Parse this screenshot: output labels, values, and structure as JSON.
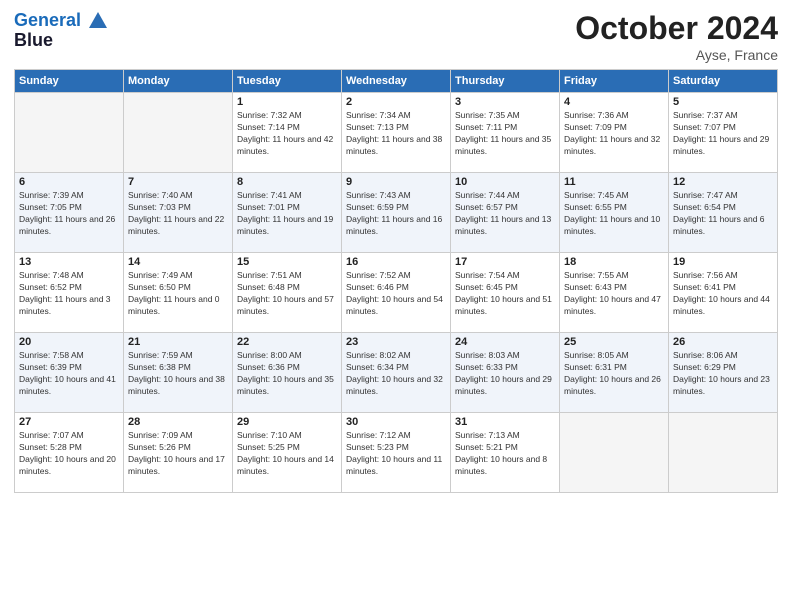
{
  "header": {
    "logo_line1": "General",
    "logo_line2": "Blue",
    "month": "October 2024",
    "location": "Ayse, France"
  },
  "weekdays": [
    "Sunday",
    "Monday",
    "Tuesday",
    "Wednesday",
    "Thursday",
    "Friday",
    "Saturday"
  ],
  "weeks": [
    [
      {
        "day": "",
        "sunrise": "",
        "sunset": "",
        "daylight": "",
        "empty": true
      },
      {
        "day": "",
        "sunrise": "",
        "sunset": "",
        "daylight": "",
        "empty": true
      },
      {
        "day": "1",
        "sunrise": "Sunrise: 7:32 AM",
        "sunset": "Sunset: 7:14 PM",
        "daylight": "Daylight: 11 hours and 42 minutes.",
        "empty": false
      },
      {
        "day": "2",
        "sunrise": "Sunrise: 7:34 AM",
        "sunset": "Sunset: 7:13 PM",
        "daylight": "Daylight: 11 hours and 38 minutes.",
        "empty": false
      },
      {
        "day": "3",
        "sunrise": "Sunrise: 7:35 AM",
        "sunset": "Sunset: 7:11 PM",
        "daylight": "Daylight: 11 hours and 35 minutes.",
        "empty": false
      },
      {
        "day": "4",
        "sunrise": "Sunrise: 7:36 AM",
        "sunset": "Sunset: 7:09 PM",
        "daylight": "Daylight: 11 hours and 32 minutes.",
        "empty": false
      },
      {
        "day": "5",
        "sunrise": "Sunrise: 7:37 AM",
        "sunset": "Sunset: 7:07 PM",
        "daylight": "Daylight: 11 hours and 29 minutes.",
        "empty": false
      }
    ],
    [
      {
        "day": "6",
        "sunrise": "Sunrise: 7:39 AM",
        "sunset": "Sunset: 7:05 PM",
        "daylight": "Daylight: 11 hours and 26 minutes.",
        "empty": false
      },
      {
        "day": "7",
        "sunrise": "Sunrise: 7:40 AM",
        "sunset": "Sunset: 7:03 PM",
        "daylight": "Daylight: 11 hours and 22 minutes.",
        "empty": false
      },
      {
        "day": "8",
        "sunrise": "Sunrise: 7:41 AM",
        "sunset": "Sunset: 7:01 PM",
        "daylight": "Daylight: 11 hours and 19 minutes.",
        "empty": false
      },
      {
        "day": "9",
        "sunrise": "Sunrise: 7:43 AM",
        "sunset": "Sunset: 6:59 PM",
        "daylight": "Daylight: 11 hours and 16 minutes.",
        "empty": false
      },
      {
        "day": "10",
        "sunrise": "Sunrise: 7:44 AM",
        "sunset": "Sunset: 6:57 PM",
        "daylight": "Daylight: 11 hours and 13 minutes.",
        "empty": false
      },
      {
        "day": "11",
        "sunrise": "Sunrise: 7:45 AM",
        "sunset": "Sunset: 6:55 PM",
        "daylight": "Daylight: 11 hours and 10 minutes.",
        "empty": false
      },
      {
        "day": "12",
        "sunrise": "Sunrise: 7:47 AM",
        "sunset": "Sunset: 6:54 PM",
        "daylight": "Daylight: 11 hours and 6 minutes.",
        "empty": false
      }
    ],
    [
      {
        "day": "13",
        "sunrise": "Sunrise: 7:48 AM",
        "sunset": "Sunset: 6:52 PM",
        "daylight": "Daylight: 11 hours and 3 minutes.",
        "empty": false
      },
      {
        "day": "14",
        "sunrise": "Sunrise: 7:49 AM",
        "sunset": "Sunset: 6:50 PM",
        "daylight": "Daylight: 11 hours and 0 minutes.",
        "empty": false
      },
      {
        "day": "15",
        "sunrise": "Sunrise: 7:51 AM",
        "sunset": "Sunset: 6:48 PM",
        "daylight": "Daylight: 10 hours and 57 minutes.",
        "empty": false
      },
      {
        "day": "16",
        "sunrise": "Sunrise: 7:52 AM",
        "sunset": "Sunset: 6:46 PM",
        "daylight": "Daylight: 10 hours and 54 minutes.",
        "empty": false
      },
      {
        "day": "17",
        "sunrise": "Sunrise: 7:54 AM",
        "sunset": "Sunset: 6:45 PM",
        "daylight": "Daylight: 10 hours and 51 minutes.",
        "empty": false
      },
      {
        "day": "18",
        "sunrise": "Sunrise: 7:55 AM",
        "sunset": "Sunset: 6:43 PM",
        "daylight": "Daylight: 10 hours and 47 minutes.",
        "empty": false
      },
      {
        "day": "19",
        "sunrise": "Sunrise: 7:56 AM",
        "sunset": "Sunset: 6:41 PM",
        "daylight": "Daylight: 10 hours and 44 minutes.",
        "empty": false
      }
    ],
    [
      {
        "day": "20",
        "sunrise": "Sunrise: 7:58 AM",
        "sunset": "Sunset: 6:39 PM",
        "daylight": "Daylight: 10 hours and 41 minutes.",
        "empty": false
      },
      {
        "day": "21",
        "sunrise": "Sunrise: 7:59 AM",
        "sunset": "Sunset: 6:38 PM",
        "daylight": "Daylight: 10 hours and 38 minutes.",
        "empty": false
      },
      {
        "day": "22",
        "sunrise": "Sunrise: 8:00 AM",
        "sunset": "Sunset: 6:36 PM",
        "daylight": "Daylight: 10 hours and 35 minutes.",
        "empty": false
      },
      {
        "day": "23",
        "sunrise": "Sunrise: 8:02 AM",
        "sunset": "Sunset: 6:34 PM",
        "daylight": "Daylight: 10 hours and 32 minutes.",
        "empty": false
      },
      {
        "day": "24",
        "sunrise": "Sunrise: 8:03 AM",
        "sunset": "Sunset: 6:33 PM",
        "daylight": "Daylight: 10 hours and 29 minutes.",
        "empty": false
      },
      {
        "day": "25",
        "sunrise": "Sunrise: 8:05 AM",
        "sunset": "Sunset: 6:31 PM",
        "daylight": "Daylight: 10 hours and 26 minutes.",
        "empty": false
      },
      {
        "day": "26",
        "sunrise": "Sunrise: 8:06 AM",
        "sunset": "Sunset: 6:29 PM",
        "daylight": "Daylight: 10 hours and 23 minutes.",
        "empty": false
      }
    ],
    [
      {
        "day": "27",
        "sunrise": "Sunrise: 7:07 AM",
        "sunset": "Sunset: 5:28 PM",
        "daylight": "Daylight: 10 hours and 20 minutes.",
        "empty": false
      },
      {
        "day": "28",
        "sunrise": "Sunrise: 7:09 AM",
        "sunset": "Sunset: 5:26 PM",
        "daylight": "Daylight: 10 hours and 17 minutes.",
        "empty": false
      },
      {
        "day": "29",
        "sunrise": "Sunrise: 7:10 AM",
        "sunset": "Sunset: 5:25 PM",
        "daylight": "Daylight: 10 hours and 14 minutes.",
        "empty": false
      },
      {
        "day": "30",
        "sunrise": "Sunrise: 7:12 AM",
        "sunset": "Sunset: 5:23 PM",
        "daylight": "Daylight: 10 hours and 11 minutes.",
        "empty": false
      },
      {
        "day": "31",
        "sunrise": "Sunrise: 7:13 AM",
        "sunset": "Sunset: 5:21 PM",
        "daylight": "Daylight: 10 hours and 8 minutes.",
        "empty": false
      },
      {
        "day": "",
        "sunrise": "",
        "sunset": "",
        "daylight": "",
        "empty": true
      },
      {
        "day": "",
        "sunrise": "",
        "sunset": "",
        "daylight": "",
        "empty": true
      }
    ]
  ]
}
